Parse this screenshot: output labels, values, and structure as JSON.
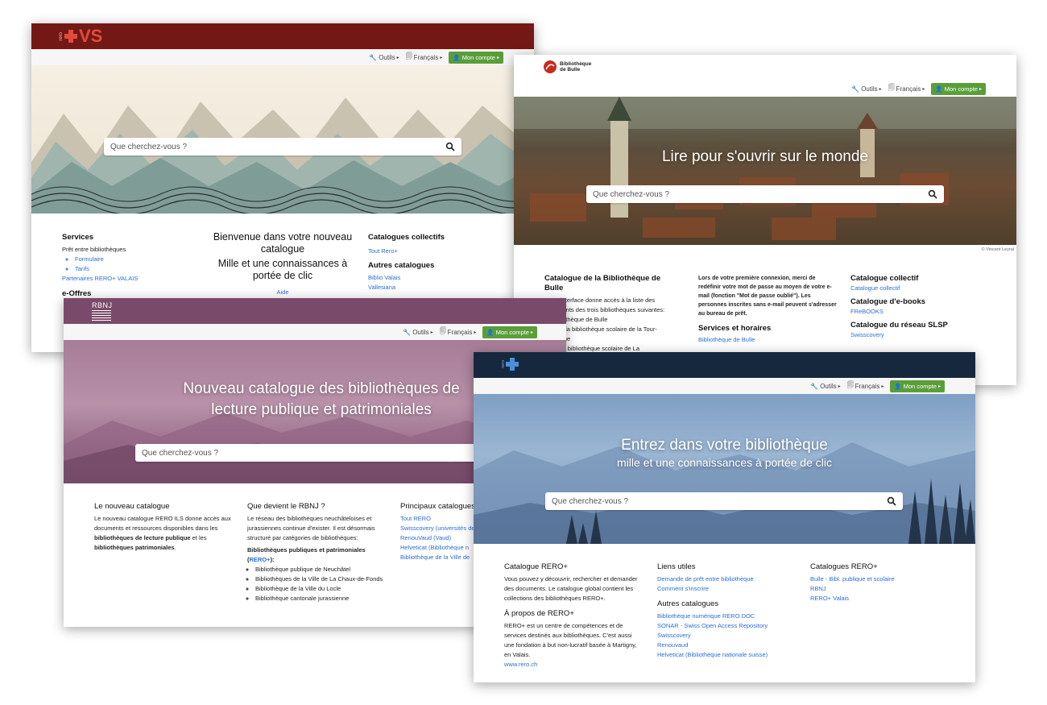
{
  "common": {
    "tools": "Outils",
    "language": "Français",
    "account": "Mon compte",
    "search_placeholder": "Que cherchez-vous ?"
  },
  "vs": {
    "logo_small": "rero",
    "logo_text": "VS",
    "services_title": "Services",
    "services_item": "Prêt entre bibliothèques",
    "services_sub": [
      "Formulaire",
      "Tarifs"
    ],
    "partners": "Partenaires RERO+ VALAIS",
    "eoffres": "e-Offres",
    "welcome_1": "Bienvenue dans votre nouveau catalogue",
    "welcome_2": "Mille et une connaissances à portée de clic",
    "aide": "Aide",
    "cat_coll_title": "Catalogues collectifs",
    "cat_coll_link": "Tout Rero+",
    "other_title": "Autres catalogues",
    "other_links": [
      "Biblio Valais",
      "Vallesiana"
    ]
  },
  "bulle": {
    "logo_line1": "Bibliothèque",
    "logo_line2": "de Bulle",
    "hero_title": "Lire pour s'ouvrir sur le monde",
    "credit": "© Vincent Leyral",
    "col1_title": "Catalogue de la Bibliothèque de Bulle",
    "col1_text": [
      "Cette interface donne accès à la liste des",
      "documents des trois bibliothèques suivantes:",
      "la Bibliothèque de Bulle",
      "la Tour, la bibliothèque scolaire de la Tour-",
      "de-Trême",
      "Bulle, la bibliothèque scolaire de La"
    ],
    "col2_text": "Lors de votre première connexion, merci de redéfinir votre mot de passe au moyen de votre e-mail (fonction \"Mot de passe oublié\"). Les personnes inscrites sans e-mail peuvent s'adresser au bureau de prêt.",
    "col2_title": "Services et horaires",
    "col2_link": "Bibliothèque de Bulle",
    "col3_t1": "Catalogue collectif",
    "col3_l1": "Catalogue collectif",
    "col3_t2": "Catalogue d'e-books",
    "col3_l2": "FReBOOKS",
    "col3_t3": "Catalogue du réseau SLSP",
    "col3_l3": "Swisscovery"
  },
  "rbnj": {
    "logo": "RBNJ",
    "hero_line1": "Nouveau catalogue des bibliothèques de",
    "hero_line2": "lecture publique et patrimoniales",
    "c1_title": "Le nouveau catalogue",
    "c1_text_a": "Le nouveau catalogue RERO ILS donne accès aux documents et ressources disponibles dans les ",
    "c1_bold1": "bibliothèques de lecture publique",
    "c1_text_b": " et les ",
    "c1_bold2": "bibliothèques patrimoniales",
    "c1_text_c": ".",
    "c2_title": "Que devient le RBNJ ?",
    "c2_text": "Le réseau des bibliothèques neuchâteloises et jurassiennes continue d'exister. Il est désormais structuré par catégories de bibliothèques:",
    "c2_sub_a": "Bibliothèques publiques et patrimoniales (",
    "c2_sub_link": "RERO+",
    "c2_sub_b": "):",
    "c2_list": [
      "Bibliothèque publique de Neuchâtel",
      "Bibliothèques de la Ville de La Chaux-de-Fonds",
      "Bibliothèque de la Ville du Locle",
      "Bibliothèque cantonale jurassienne"
    ],
    "c3_title": "Principaux catalogues",
    "c3_links": [
      "Tout RERO",
      "Swisscovery (universités de",
      "RenouVaud (Vaud)",
      "Helveticat (Bibliothèque n",
      "Bibliothèque de la Ville de"
    ]
  },
  "rero": {
    "logo_small": "rero",
    "hero_line1": "Entrez dans votre bibliothèque",
    "hero_line2": "mille et une connaissances à portée de clic",
    "c1_title": "Catalogue RERO+",
    "c1_text": "Vous pouvez y découvrir, rechercher et demander des documents. Le catalogue global contient les collections des bibliothèques RERO+.",
    "c1_title2": "À propos de RERO+",
    "c1_text2": "RERO+ est un centre de compétences et de services destinés aux bibliothèques. C'est aussi une fondation à but non-lucratif basée à Martigny, en Valais.",
    "c1_link": "www.rero.ch",
    "c2_title": "Liens utiles",
    "c2_links": [
      "Demande de prêt entre bibliothèque",
      "Comment s'inscrire"
    ],
    "c2_title2": "Autres catalogues",
    "c2_links2": [
      "Bibliothèque numérique RERO DOC",
      "SONAR - Swiss Open Access Repository",
      "Swisscovery",
      "Renouvaud",
      "Helveticat (Bibliothèque nationale suisse)"
    ],
    "c3_title": "Catalogues RERO+",
    "c3_links": [
      "Bulle - Bibl. publique et scolaire",
      "RBNJ",
      "RERO+ Valais"
    ]
  }
}
